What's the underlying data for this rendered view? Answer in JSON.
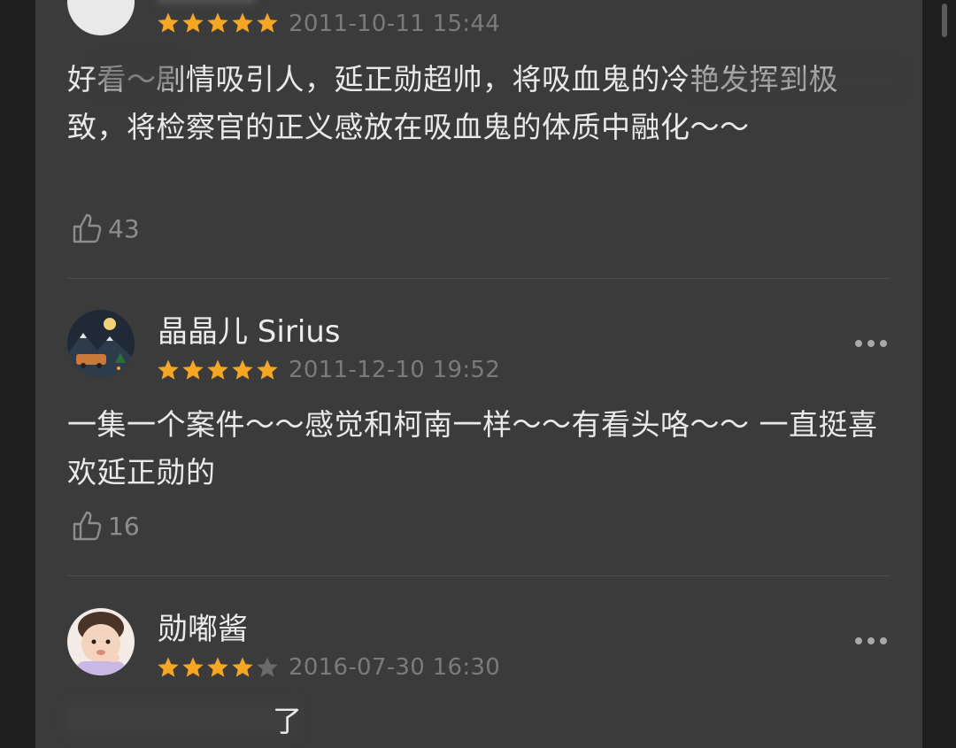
{
  "colors": {
    "panel_bg": "#3b3b3b",
    "star_filled": "#f5a623",
    "star_empty": "#6a6a6a",
    "date_text": "#7b7b7b",
    "body_text": "#e9e9e9"
  },
  "reviews": [
    {
      "username": "",
      "rating": 5,
      "date": "2011-10-11 15:44",
      "text": "好看～剧情吸引人，延正勋超帅，将吸血鬼的冷艳发挥到极致，将检察官的正义感放在吸血鬼的体质中融化～～",
      "likes": "43"
    },
    {
      "username": "晶晶儿 Sirius",
      "rating": 5,
      "date": "2011-12-10 19:52",
      "text": "一集一个案件～～感觉和柯南一样～～有看头咯～～ 一直挺喜欢延正勋的",
      "likes": "16"
    },
    {
      "username": "勋嘟酱",
      "rating": 4,
      "date": "2016-07-30 16:30",
      "text": "了",
      "likes": ""
    }
  ],
  "icons": {
    "more": "more-dots-icon",
    "like": "thumbs-up-icon",
    "star": "star-icon"
  }
}
